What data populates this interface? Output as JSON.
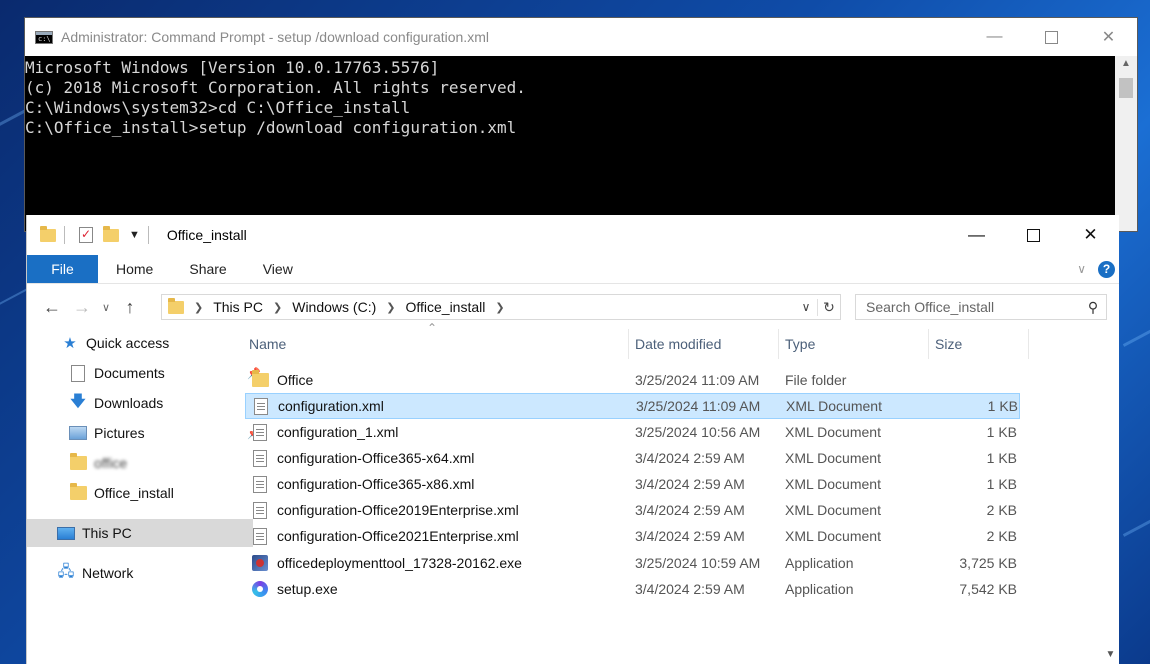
{
  "cmd": {
    "title": "Administrator: Command Prompt - setup  /download configuration.xml",
    "lines": [
      "Microsoft Windows [Version 10.0.17763.5576]",
      "(c) 2018 Microsoft Corporation. All rights reserved.",
      "",
      "C:\\Windows\\system32>cd C:\\Office_install",
      "",
      "C:\\Office_install>setup /download configuration.xml"
    ]
  },
  "explorer": {
    "title": "Office_install",
    "ribbon": {
      "file": "File",
      "home": "Home",
      "share": "Share",
      "view": "View"
    },
    "breadcrumb": [
      "This PC",
      "Windows (C:)",
      "Office_install"
    ],
    "search_placeholder": "Search Office_install",
    "nav": {
      "quick_access": "Quick access",
      "documents": "Documents",
      "downloads": "Downloads",
      "pictures": "Pictures",
      "blurred": "office",
      "office_install": "Office_install",
      "this_pc": "This PC",
      "network": "Network"
    },
    "columns": {
      "name": "Name",
      "date": "Date modified",
      "type": "Type",
      "size": "Size"
    },
    "files": [
      {
        "name": "Office",
        "date": "3/25/2024 11:09 AM",
        "type": "File folder",
        "size": "",
        "icon": "folder"
      },
      {
        "name": "configuration.xml",
        "date": "3/25/2024 11:09 AM",
        "type": "XML Document",
        "size": "1 KB",
        "icon": "xml"
      },
      {
        "name": "configuration_1.xml",
        "date": "3/25/2024 10:56 AM",
        "type": "XML Document",
        "size": "1 KB",
        "icon": "xml"
      },
      {
        "name": "configuration-Office365-x64.xml",
        "date": "3/4/2024 2:59 AM",
        "type": "XML Document",
        "size": "1 KB",
        "icon": "xml"
      },
      {
        "name": "configuration-Office365-x86.xml",
        "date": "3/4/2024 2:59 AM",
        "type": "XML Document",
        "size": "1 KB",
        "icon": "xml"
      },
      {
        "name": "configuration-Office2019Enterprise.xml",
        "date": "3/4/2024 2:59 AM",
        "type": "XML Document",
        "size": "2 KB",
        "icon": "xml"
      },
      {
        "name": "configuration-Office2021Enterprise.xml",
        "date": "3/4/2024 2:59 AM",
        "type": "XML Document",
        "size": "2 KB",
        "icon": "xml"
      },
      {
        "name": "officedeploymenttool_17328-20162.exe",
        "date": "3/25/2024 10:59 AM",
        "type": "Application",
        "size": "3,725 KB",
        "icon": "exe"
      },
      {
        "name": "setup.exe",
        "date": "3/4/2024 2:59 AM",
        "type": "Application",
        "size": "7,542 KB",
        "icon": "setup"
      }
    ],
    "selected_index": 1
  }
}
